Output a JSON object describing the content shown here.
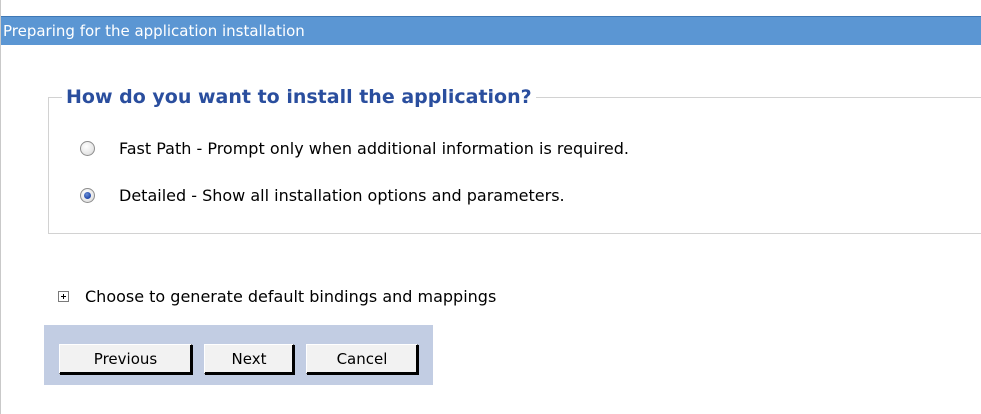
{
  "window": {
    "title": "Preparing for the application installation"
  },
  "install_options": {
    "legend": "How do you want to install the application?",
    "options": [
      {
        "label": "Fast Path - Prompt only when additional information is required.",
        "selected": false
      },
      {
        "label": "Detailed - Show all installation options and parameters.",
        "selected": true
      }
    ]
  },
  "bindings": {
    "label": "Choose to generate default bindings and mappings",
    "expanded": false
  },
  "buttons": {
    "previous": "Previous",
    "next": "Next",
    "cancel": "Cancel"
  },
  "colors": {
    "titlebar": "#5b96d3",
    "legend": "#2a4e9e",
    "button_bar": "#c2cde3"
  }
}
